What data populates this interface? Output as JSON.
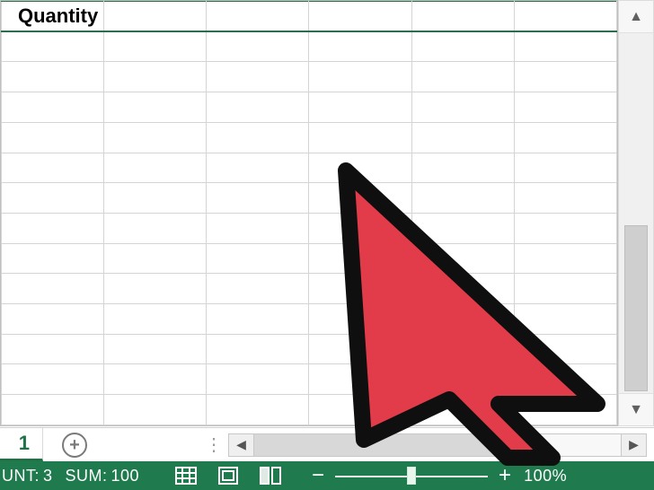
{
  "column_header": "Quantity",
  "sheet_tab_visible_text": "1",
  "statusbar": {
    "count_label": "UNT:",
    "count_value": "3",
    "sum_label": "SUM:",
    "sum_value": "100",
    "zoom_percent": "100%"
  },
  "icons": {
    "add_sheet_glyph": "+",
    "scroll_up_glyph": "▲",
    "scroll_down_glyph": "▼",
    "scroll_left_glyph": "◀",
    "scroll_right_glyph": "▶",
    "zoom_minus": "−",
    "zoom_plus": "+",
    "grip": "⋮"
  },
  "colors": {
    "brand_green": "#1f7a4d",
    "header_rule": "#2a6e4c",
    "cursor_fill": "#e23b4a",
    "cursor_stroke": "#0f0f0f"
  }
}
